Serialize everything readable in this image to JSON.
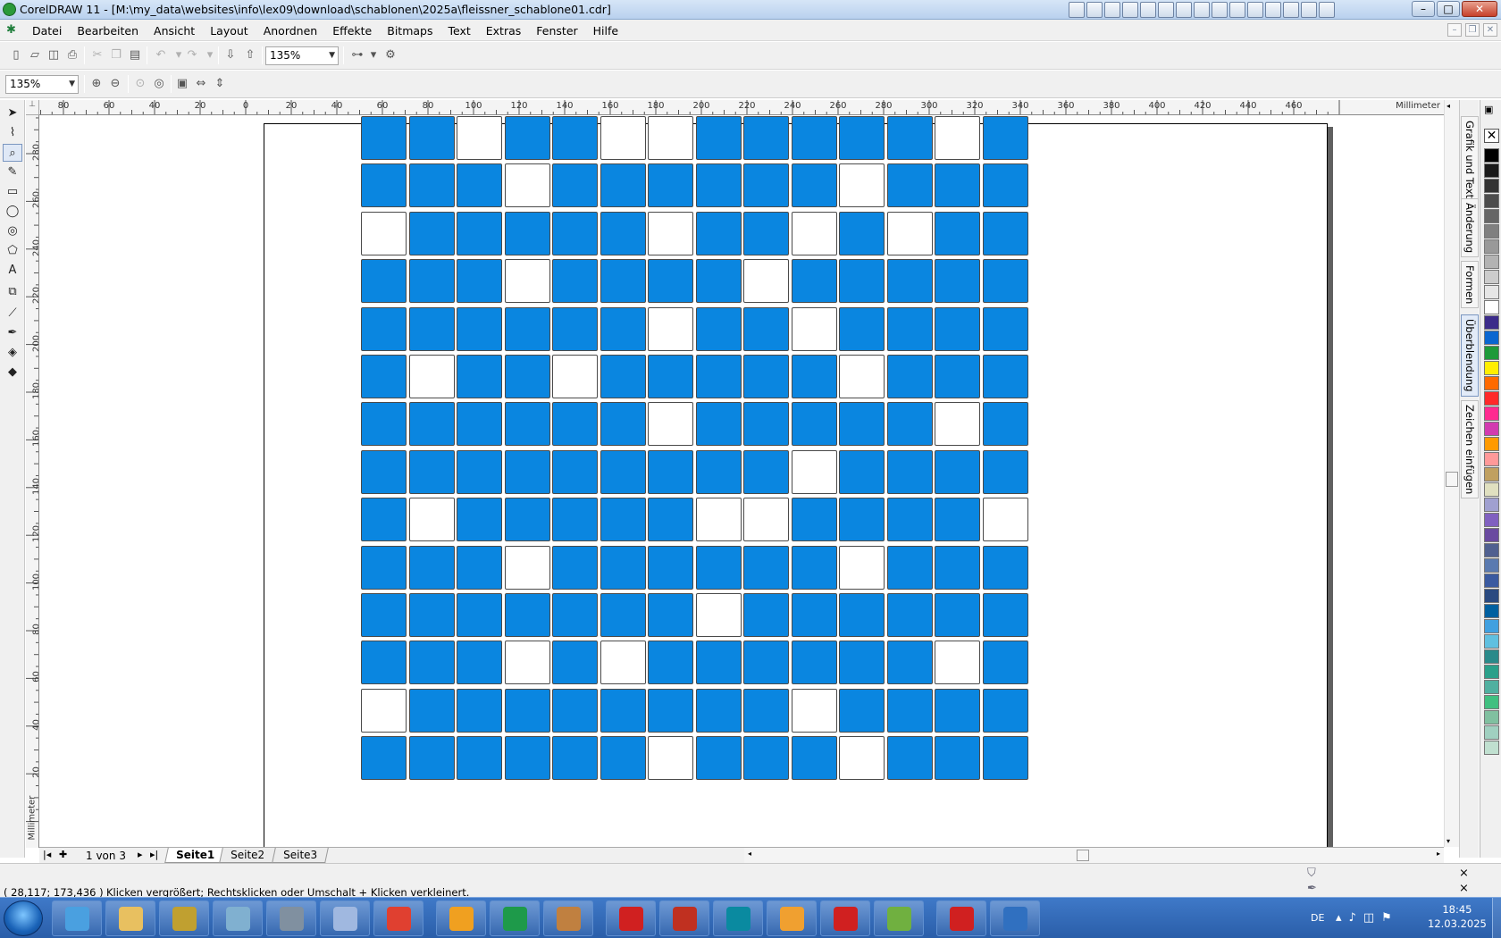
{
  "window": {
    "title": "CorelDRAW 11 - [M:\\my_data\\websites\\info\\lex09\\download\\schablonen\\2025a\\fleissner_schablone01.cdr]",
    "minimize": "–",
    "maximize": "□",
    "close": "✕"
  },
  "menu": {
    "items": [
      "Datei",
      "Bearbeiten",
      "Ansicht",
      "Layout",
      "Anordnen",
      "Effekte",
      "Bitmaps",
      "Text",
      "Extras",
      "Fenster",
      "Hilfe"
    ]
  },
  "toolbar": {
    "zoom_main": "135%",
    "zoom_secondary": "135%"
  },
  "rulers": {
    "unit": "Millimeter",
    "h_labels": [
      "80",
      "60",
      "40",
      "20",
      "0",
      "20",
      "40",
      "60",
      "80",
      "100",
      "120",
      "140",
      "160",
      "180",
      "200",
      "220",
      "240",
      "260",
      "280",
      "300",
      "320",
      "340",
      "360",
      "380",
      "400",
      "420",
      "440",
      "460"
    ],
    "v_labels": [
      "280",
      "260",
      "240",
      "220",
      "200",
      "180",
      "160",
      "140",
      "120",
      "100",
      "80",
      "60",
      "40",
      "20"
    ],
    "corner": "⊥"
  },
  "grid": {
    "rows": [
      [
        1,
        1,
        0,
        1,
        1,
        0,
        0,
        1,
        1,
        1,
        1,
        1,
        0,
        1
      ],
      [
        1,
        1,
        1,
        0,
        1,
        1,
        1,
        1,
        1,
        1,
        0,
        1,
        1,
        1
      ],
      [
        0,
        1,
        1,
        1,
        1,
        1,
        0,
        1,
        1,
        0,
        1,
        0,
        1,
        1
      ],
      [
        1,
        1,
        1,
        0,
        1,
        1,
        1,
        1,
        0,
        1,
        1,
        1,
        1,
        1
      ],
      [
        1,
        1,
        1,
        1,
        1,
        1,
        0,
        1,
        1,
        0,
        1,
        1,
        1,
        1
      ],
      [
        1,
        0,
        1,
        1,
        0,
        1,
        1,
        1,
        1,
        1,
        0,
        1,
        1,
        1
      ],
      [
        1,
        1,
        1,
        1,
        1,
        1,
        0,
        1,
        1,
        1,
        1,
        1,
        0,
        1
      ],
      [
        1,
        1,
        1,
        1,
        1,
        1,
        1,
        1,
        1,
        0,
        1,
        1,
        1,
        1
      ],
      [
        1,
        0,
        1,
        1,
        1,
        1,
        1,
        0,
        0,
        1,
        1,
        1,
        1,
        0
      ],
      [
        1,
        1,
        1,
        0,
        1,
        1,
        1,
        1,
        1,
        1,
        0,
        1,
        1,
        1
      ],
      [
        1,
        1,
        1,
        1,
        1,
        1,
        1,
        0,
        1,
        1,
        1,
        1,
        1,
        1
      ],
      [
        1,
        1,
        1,
        0,
        1,
        0,
        1,
        1,
        1,
        1,
        1,
        1,
        0,
        1
      ],
      [
        0,
        1,
        1,
        1,
        1,
        1,
        1,
        1,
        1,
        0,
        1,
        1,
        1,
        1
      ],
      [
        1,
        1,
        1,
        1,
        1,
        1,
        0,
        1,
        1,
        1,
        0,
        1,
        1,
        1
      ]
    ],
    "fill_color": "#0a86e0",
    "empty_color": "#ffffff"
  },
  "dockers": [
    "Grafik und Text",
    "Änderung",
    "Formen",
    "Überblendung",
    "Zeichen einfügen"
  ],
  "palette": [
    "#000000",
    "#1a1a1a",
    "#333333",
    "#4d4d4d",
    "#666666",
    "#808080",
    "#999999",
    "#b3b3b3",
    "#cccccc",
    "#e6e6e6",
    "#ffffff",
    "#3b2b8a",
    "#0a66d0",
    "#1f9a3a",
    "#ffee00",
    "#ff6a00",
    "#ff2a2a",
    "#ff2a90",
    "#d23bb0",
    "#ff9a00",
    "#ff9999",
    "#c0a060",
    "#e0e0c0",
    "#a0a0d0",
    "#8060c0",
    "#6a4aa0",
    "#506090",
    "#5a7ab0",
    "#3a5aa0",
    "#2a4a80",
    "#0060a0",
    "#40a0e0",
    "#60c0e0",
    "#2a8a8a",
    "#2aa08a",
    "#50b0a0",
    "#40c080",
    "#80c0a0",
    "#a0d0c0",
    "#c0e0d0"
  ],
  "pages": {
    "counter": "1 von 3",
    "tabs": [
      "Seite1",
      "Seite2",
      "Seite3"
    ],
    "active": "Seite1"
  },
  "status": {
    "coords": "( 28,117; 173,436 )",
    "hint": "Klicken vergrößert; Rechtsklicken oder Umschalt + Klicken verkleinert."
  },
  "taskbar": {
    "lang": "DE",
    "time": "18:45",
    "date": "12.03.2025",
    "apps": [
      "explorer",
      "files",
      "settings",
      "notes",
      "calendar",
      "calculator",
      "chrome",
      "media",
      "coreldraw",
      "painter",
      "pdfeditor",
      "paint",
      "arduino",
      "bitcoin",
      "meta",
      "notepad",
      "pdfreader",
      "quicktime"
    ]
  },
  "colors": {
    "accent": "#0a86e0"
  }
}
